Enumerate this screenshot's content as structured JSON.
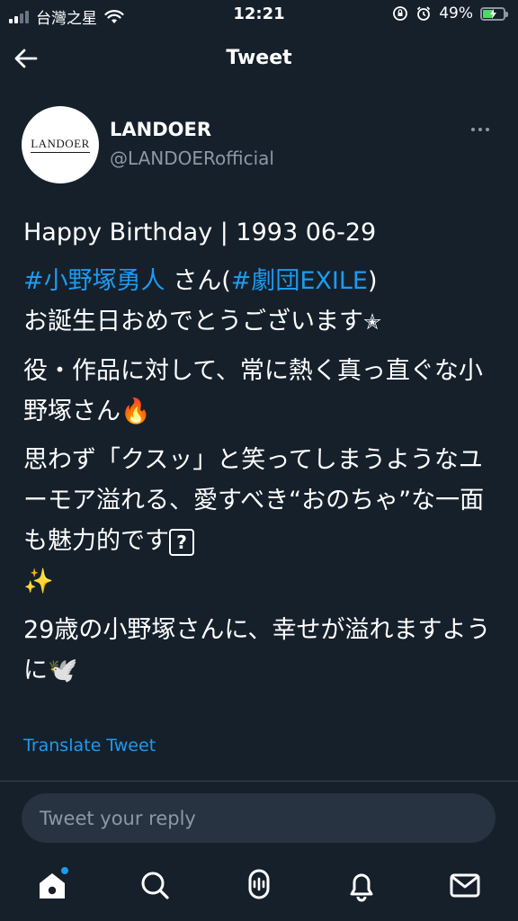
{
  "status_bar": {
    "carrier": "台灣之星",
    "time": "12:21",
    "battery_percent": "49%",
    "battery_level": 0.49,
    "battery_fill_color": "#4cd964"
  },
  "header": {
    "title": "Tweet",
    "back_icon": "arrow-left-icon"
  },
  "author": {
    "logo_text": "LANDOER",
    "name": "LANDOER",
    "handle": "@LANDOERofficial"
  },
  "tweet": {
    "line1": "Happy Birthday | 1993 06-29",
    "hashtag1": "#小野塚勇人",
    "text_san": " さん(",
    "hashtag2": "#劇団EXILE",
    "text_close": ")",
    "line2": "お誕生日おめでとうございます",
    "star_emoji": "✭",
    "para2": "役・作品に対して、常に熱く真っ直ぐな小野塚さん",
    "fire_emoji": "🔥",
    "para3": "思わず「クスッ」と笑ってしまうようなユーモア溢れる、愛すべき“おのちゃ”な一面も魅力的です",
    "qbox": "?",
    "sparkles_emoji": "✨",
    "para4": "29歳の小野塚さんに、幸せが溢れますように",
    "dove_emoji": "🕊️"
  },
  "translate_label": "Translate Tweet",
  "reply_placeholder": "Tweet your reply",
  "nav": [
    "home-icon",
    "search-icon",
    "spaces-icon",
    "notifications-icon",
    "messages-icon"
  ],
  "colors": {
    "background": "#15202b",
    "accent": "#1d9bf0",
    "muted": "#8b98a5"
  }
}
